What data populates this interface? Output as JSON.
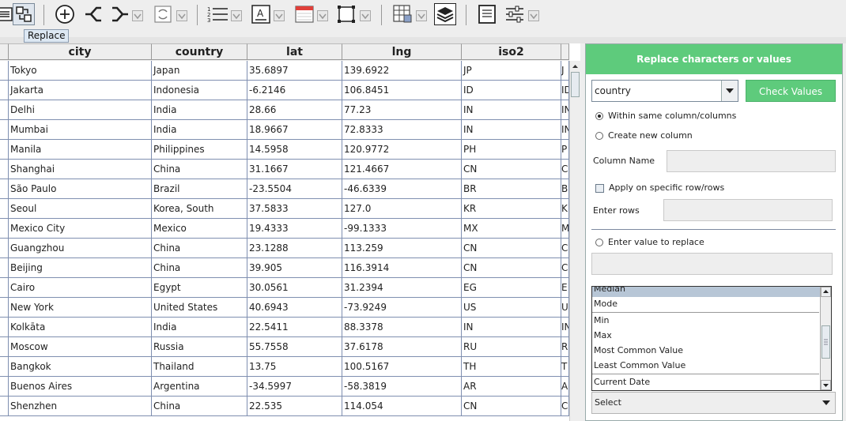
{
  "toolbar": {
    "tooltip": "Replace",
    "buttons": [
      {
        "name": "list-view-icon"
      },
      {
        "name": "replace-icon"
      },
      {
        "name": "add-circle-icon"
      },
      {
        "name": "split-icon"
      },
      {
        "name": "merge-icon"
      },
      {
        "name": "refresh-doc-icon"
      },
      {
        "name": "numbered-list-icon"
      },
      {
        "name": "text-format-icon"
      },
      {
        "name": "calendar-icon"
      },
      {
        "name": "frame-icon"
      },
      {
        "name": "grid-edit-icon"
      },
      {
        "name": "layers-icon"
      },
      {
        "name": "document-icon"
      },
      {
        "name": "sliders-icon"
      }
    ]
  },
  "table": {
    "columns": [
      "city",
      "country",
      "lat",
      "lng",
      "iso2"
    ],
    "rows": [
      [
        "Tokyo",
        "Japan",
        "35.6897",
        "139.6922",
        "JP",
        "J"
      ],
      [
        "Jakarta",
        "Indonesia",
        "-6.2146",
        "106.8451",
        "ID",
        "ID"
      ],
      [
        "Delhi",
        "India",
        "28.66",
        "77.23",
        "IN",
        "IN"
      ],
      [
        "Mumbai",
        "India",
        "18.9667",
        "72.8333",
        "IN",
        "IN"
      ],
      [
        "Manila",
        "Philippines",
        "14.5958",
        "120.9772",
        "PH",
        "P"
      ],
      [
        "Shanghai",
        "China",
        "31.1667",
        "121.4667",
        "CN",
        "C"
      ],
      [
        "São Paulo",
        "Brazil",
        "-23.5504",
        "-46.6339",
        "BR",
        "B"
      ],
      [
        "Seoul",
        "Korea, South",
        "37.5833",
        "127.0",
        "KR",
        "K"
      ],
      [
        "Mexico City",
        "Mexico",
        "19.4333",
        "-99.1333",
        "MX",
        "M"
      ],
      [
        "Guangzhou",
        "China",
        "23.1288",
        "113.259",
        "CN",
        "C"
      ],
      [
        "Beijing",
        "China",
        "39.905",
        "116.3914",
        "CN",
        "C"
      ],
      [
        "Cairo",
        "Egypt",
        "30.0561",
        "31.2394",
        "EG",
        "E"
      ],
      [
        "New York",
        "United States",
        "40.6943",
        "-73.9249",
        "US",
        "U"
      ],
      [
        "Kolkāta",
        "India",
        "22.5411",
        "88.3378",
        "IN",
        "IN"
      ],
      [
        "Moscow",
        "Russia",
        "55.7558",
        "37.6178",
        "RU",
        "R"
      ],
      [
        "Bangkok",
        "Thailand",
        "13.75",
        "100.5167",
        "TH",
        "T"
      ],
      [
        "Buenos Aires",
        "Argentina",
        "-34.5997",
        "-58.3819",
        "AR",
        "A"
      ],
      [
        "Shenzhen",
        "China",
        "22.535",
        "114.054",
        "CN",
        "C"
      ]
    ]
  },
  "panel": {
    "title": "Replace characters or values",
    "column_select": "country",
    "check_button": "Check Values",
    "opt_same_column": "Within same column/columns",
    "opt_new_column": "Create new column",
    "column_name_label": "Column Name",
    "apply_rows_label": "Apply on specific row/rows",
    "enter_rows_label": "Enter rows",
    "enter_value_label": "Enter value to replace",
    "list_items": [
      "Median",
      "Mode",
      "Min",
      "Max",
      "Most Common Value",
      "Least Common Value",
      "Current Date"
    ],
    "select_value": "Select"
  }
}
